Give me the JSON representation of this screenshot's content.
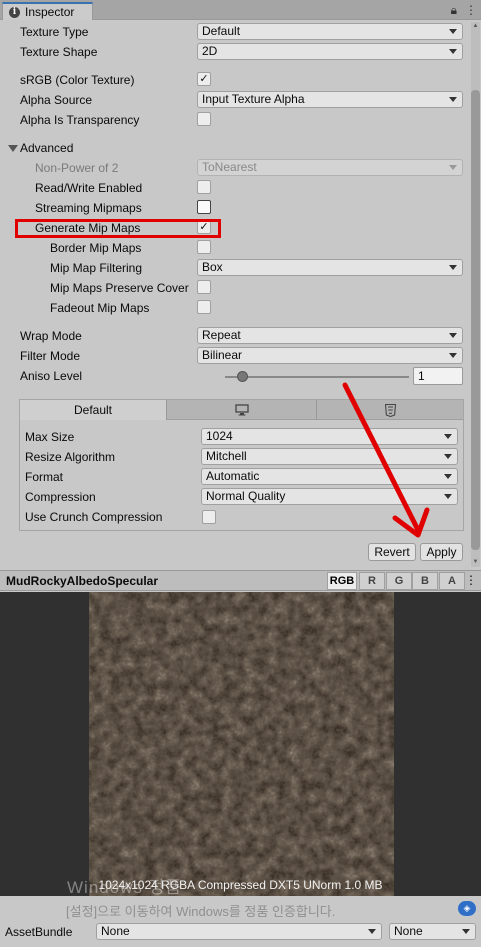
{
  "tab": {
    "title": "Inspector"
  },
  "fields": {
    "texture_type": {
      "label": "Texture Type",
      "value": "Default"
    },
    "texture_shape": {
      "label": "Texture Shape",
      "value": "2D"
    },
    "srgb": {
      "label": "sRGB (Color Texture)",
      "checked": "✓"
    },
    "alpha_source": {
      "label": "Alpha Source",
      "value": "Input Texture Alpha"
    },
    "alpha_transparency": {
      "label": "Alpha Is Transparency",
      "checked": ""
    }
  },
  "advanced": {
    "label": "Advanced",
    "non_power_of_2": {
      "label": "Non-Power of 2",
      "value": "ToNearest"
    },
    "read_write": {
      "label": "Read/Write Enabled",
      "checked": ""
    },
    "streaming_mipmaps": {
      "label": "Streaming Mipmaps",
      "checked": ""
    },
    "generate_mip_maps": {
      "label": "Generate Mip Maps",
      "checked": "✓"
    },
    "border_mip_maps": {
      "label": "Border Mip Maps",
      "checked": ""
    },
    "mip_map_filtering": {
      "label": "Mip Map Filtering",
      "value": "Box"
    },
    "mip_maps_preserve_cover": {
      "label": "Mip Maps Preserve Cover",
      "checked": ""
    },
    "fadeout_mip_maps": {
      "label": "Fadeout Mip Maps",
      "checked": ""
    }
  },
  "wrap_mode": {
    "label": "Wrap Mode",
    "value": "Repeat"
  },
  "filter_mode": {
    "label": "Filter Mode",
    "value": "Bilinear"
  },
  "aniso_level": {
    "label": "Aniso Level",
    "value": "1",
    "min": 0,
    "max": 16
  },
  "platform": {
    "tabs": [
      {
        "label": "Default",
        "icon": ""
      },
      {
        "label": "",
        "icon": "monitor-icon"
      },
      {
        "label": "",
        "icon": "html5-icon"
      }
    ],
    "max_size": {
      "label": "Max Size",
      "value": "1024"
    },
    "resize_algorithm": {
      "label": "Resize Algorithm",
      "value": "Mitchell"
    },
    "format": {
      "label": "Format",
      "value": "Automatic"
    },
    "compression": {
      "label": "Compression",
      "value": "Normal Quality"
    },
    "crunch": {
      "label": "Use Crunch Compression",
      "checked": ""
    }
  },
  "buttons": {
    "revert": "Revert",
    "apply": "Apply"
  },
  "preview": {
    "title": "MudRockyAlbedoSpecular",
    "channels": [
      "RGB",
      "R",
      "G",
      "B",
      "A"
    ],
    "info": "1024x1024  RGBA Compressed DXT5 UNorm   1.0 MB",
    "watermark_line1": "Windows 정품",
    "watermark_line2": "[설정]으로 이동하여 Windows를 정품 인증합니다."
  },
  "asset_bundle": {
    "label": "AssetBundle",
    "name": "None",
    "variant": "None"
  },
  "colors": {
    "highlight": "#e00000",
    "arrow": "#e00000",
    "tab_accent": "#3a72b0"
  }
}
